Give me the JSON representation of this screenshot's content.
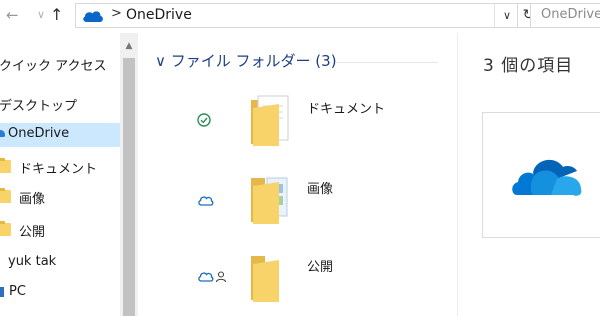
{
  "address_bar": {
    "path_separator": ">",
    "location": "OneDrive",
    "search_placeholder": "OneDrive"
  },
  "nav_pane": {
    "items": [
      {
        "label": "クイック アクセス",
        "icon": "star-icon"
      },
      {
        "label": "デスクトップ",
        "icon": "desktop-icon"
      },
      {
        "label": "OneDrive",
        "icon": "onedrive-cloud-icon",
        "selected": true
      },
      {
        "label": "ドキュメント",
        "icon": "folder-icon"
      },
      {
        "label": "画像",
        "icon": "folder-icon"
      },
      {
        "label": "公開",
        "icon": "folder-icon"
      },
      {
        "label": "yuk tak",
        "icon": "user-icon"
      },
      {
        "label": "PC",
        "icon": "pc-icon"
      }
    ]
  },
  "content": {
    "group_header": "ファイル フォルダー (3)",
    "files": [
      {
        "name": "ドキュメント",
        "status": "synced-check",
        "status_icon": "sync-check-icon"
      },
      {
        "name": "画像",
        "status": "cloud-only",
        "status_icon": "cloud-status-icon"
      },
      {
        "name": "公開",
        "status": "cloud-shared",
        "status_icon": "cloud-shared-status-icon"
      }
    ]
  },
  "details_pane": {
    "item_count": "3 個の項目",
    "preview_icon": "onedrive-logo-icon"
  },
  "colors": {
    "accent_blue": "#0364b8",
    "selection": "#cce8ff",
    "folder_yellow": "#f7d369",
    "header_blue": "#1e3f87",
    "sync_green": "#2e8b57"
  }
}
